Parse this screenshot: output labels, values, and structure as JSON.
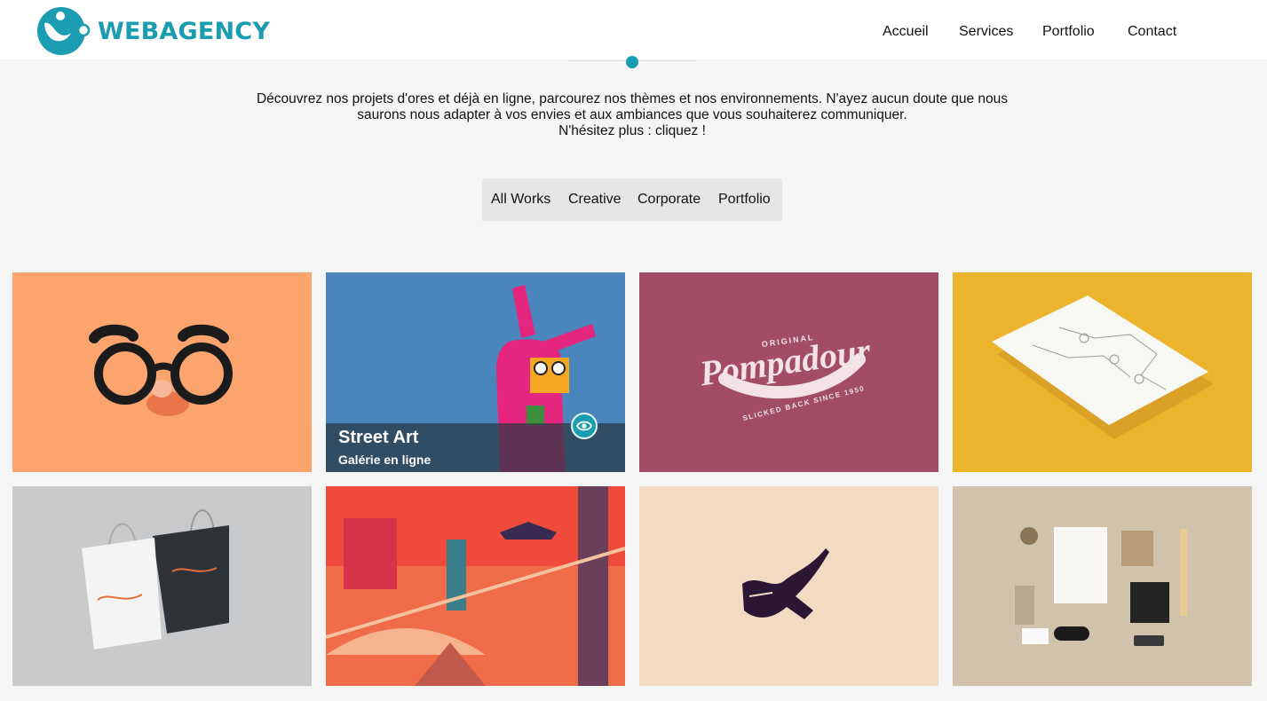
{
  "brand": {
    "name": "WEBAGENCY",
    "accent_color": "#1a9db0"
  },
  "nav": {
    "items": [
      {
        "label": "Accueil"
      },
      {
        "label": "Services"
      },
      {
        "label": "Portfolio"
      },
      {
        "label": "Contact"
      }
    ]
  },
  "intro": {
    "line1": "Découvrez nos projets d'ores et déjà en ligne, parcourez nos thèmes et nos environnements. N'ayez aucun doute que nous",
    "line2": "saurons nous adapter à vos envies et aux ambiances que vous souhaiterez communiquer.",
    "line3": "N'hésitez plus : cliquez !"
  },
  "filters": {
    "items": [
      {
        "label": "All Works"
      },
      {
        "label": "Creative"
      },
      {
        "label": "Corporate"
      },
      {
        "label": "Portfolio"
      }
    ]
  },
  "portfolio": {
    "items": [
      {
        "image": "glasses-disguise-image",
        "background": "#fba46d"
      },
      {
        "image": "pink-rabbit-street-art-image",
        "background": "#4a86bd",
        "hover_title": "Street Art",
        "hover_subtitle": "Galérie en ligne",
        "hover_icon": "eye-icon"
      },
      {
        "image": "pompadour-logo-image",
        "background": "#a24c66",
        "logo_top": "ORIGINAL",
        "logo_main": "Pompadour",
        "logo_bottom": "SLICKED BACK SINCE 1950"
      },
      {
        "image": "stationery-paper-image",
        "background": "#ecb42c"
      },
      {
        "image": "shopping-bags-mockup-image",
        "background": "#c9cacc"
      },
      {
        "image": "city-illustration-image",
        "background": "#f06b47"
      },
      {
        "image": "pen-bird-logo-image",
        "background": "#f2dac3"
      },
      {
        "image": "branding-mockup-image",
        "background": "#d1c2ab"
      }
    ]
  }
}
